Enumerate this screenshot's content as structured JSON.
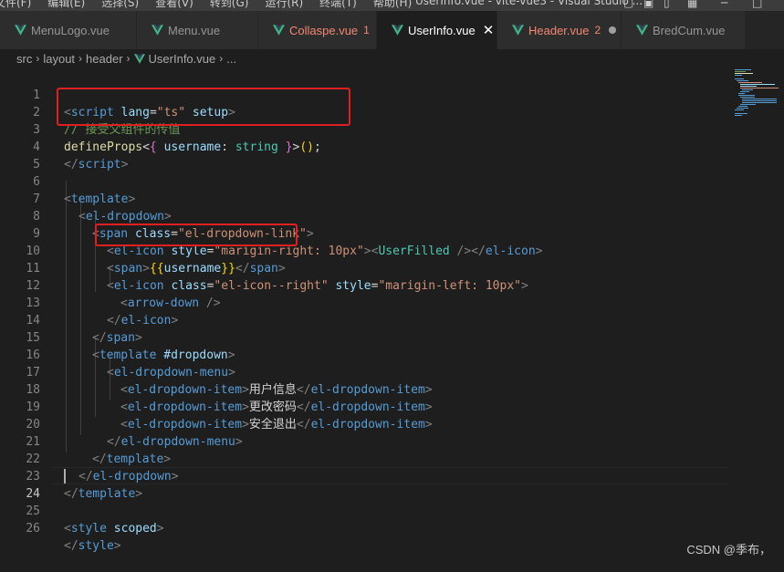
{
  "menubar": {
    "items": [
      "文件(F)",
      "编辑(E)",
      "选择(S)",
      "查看(V)",
      "转到(G)",
      "运行(R)",
      "终端(T)",
      "帮助(H)"
    ],
    "title": "UserInfo.vue - vite-vue3 - Visual Studio ..."
  },
  "tabs": [
    {
      "label": "MenuLogo.vue",
      "icon": "vue-icon"
    },
    {
      "label": "Menu.vue",
      "icon": "vue-icon"
    },
    {
      "label": "Collaspe.vue",
      "count": "1",
      "icon": "vue-icon"
    },
    {
      "label": "UserInfo.vue",
      "close": "✕",
      "icon": "vue-icon"
    },
    {
      "label": "Header.vue",
      "count": "2",
      "icon": "vue-icon"
    },
    {
      "label": "BredCum.vue",
      "icon": "vue-icon"
    }
  ],
  "breadcrumb": {
    "parts": [
      "src",
      "layout",
      "header",
      "UserInfo.vue",
      "..."
    ]
  },
  "line_numbers": [
    "1",
    "2",
    "3",
    "4",
    "5",
    "6",
    "7",
    "8",
    "9",
    "10",
    "11",
    "12",
    "13",
    "14",
    "15",
    "16",
    "17",
    "18",
    "19",
    "20",
    "21",
    "22",
    "23",
    "24",
    "25",
    "26"
  ],
  "code": {
    "l1": [
      "<",
      "script",
      " ",
      "lang",
      "=",
      "\"ts\"",
      " ",
      "setup",
      ">"
    ],
    "l2": "// 接受父组件的传值",
    "l3": [
      "defineProps",
      "<",
      "{",
      " username",
      ": ",
      "string",
      " }",
      ">",
      "(",
      ")",
      ";"
    ],
    "l4": [
      "</",
      "script",
      ">"
    ],
    "l6": [
      "<",
      "template",
      ">"
    ],
    "l7": [
      "<",
      "el-dropdown",
      ">"
    ],
    "l8": [
      "<",
      "span",
      " ",
      "class",
      "=",
      "\"el-dropdown-link\"",
      ">"
    ],
    "l9": [
      "<",
      "el-icon",
      " ",
      "style",
      "=",
      "\"marigin-right: 10px\"",
      ">",
      "<",
      "UserFilled",
      " />",
      "</",
      "el-icon",
      ">"
    ],
    "l10": [
      "<",
      "span",
      ">",
      "{{",
      "username",
      "}}",
      "</",
      "span",
      ">"
    ],
    "l11": [
      "<",
      "el-icon",
      " ",
      "class",
      "=",
      "\"el-icon--right\"",
      " ",
      "style",
      "=",
      "\"marigin-left: 10px\"",
      ">"
    ],
    "l12": [
      "<",
      "arrow-down",
      " />"
    ],
    "l13": [
      "</",
      "el-icon",
      ">"
    ],
    "l14": [
      "</",
      "span",
      ">"
    ],
    "l15": [
      "<",
      "template",
      " ",
      "#dropdown",
      ">"
    ],
    "l16": [
      "<",
      "el-dropdown-menu",
      ">"
    ],
    "l17": [
      "<",
      "el-dropdown-item",
      ">",
      "用户信息",
      "</",
      "el-dropdown-item",
      ">"
    ],
    "l18": [
      "<",
      "el-dropdown-item",
      ">",
      "更改密码",
      "</",
      "el-dropdown-item",
      ">"
    ],
    "l19": [
      "<",
      "el-dropdown-item",
      ">",
      "安全退出",
      "</",
      "el-dropdown-item",
      ">"
    ],
    "l20": [
      "</",
      "el-dropdown-menu",
      ">"
    ],
    "l21": [
      "</",
      "template",
      ">"
    ],
    "l22": [
      "</",
      "el-dropdown",
      ">"
    ],
    "l23": [
      "</",
      "template",
      ">"
    ],
    "l25": [
      "<",
      "style",
      " ",
      "scoped",
      ">"
    ],
    "l26": [
      "</",
      "style",
      ">"
    ]
  },
  "watermark": "CSDN @季布，",
  "colors": {
    "accent_vue": "#41b883",
    "error": "#f48771",
    "highlight_box": "#e02020"
  }
}
